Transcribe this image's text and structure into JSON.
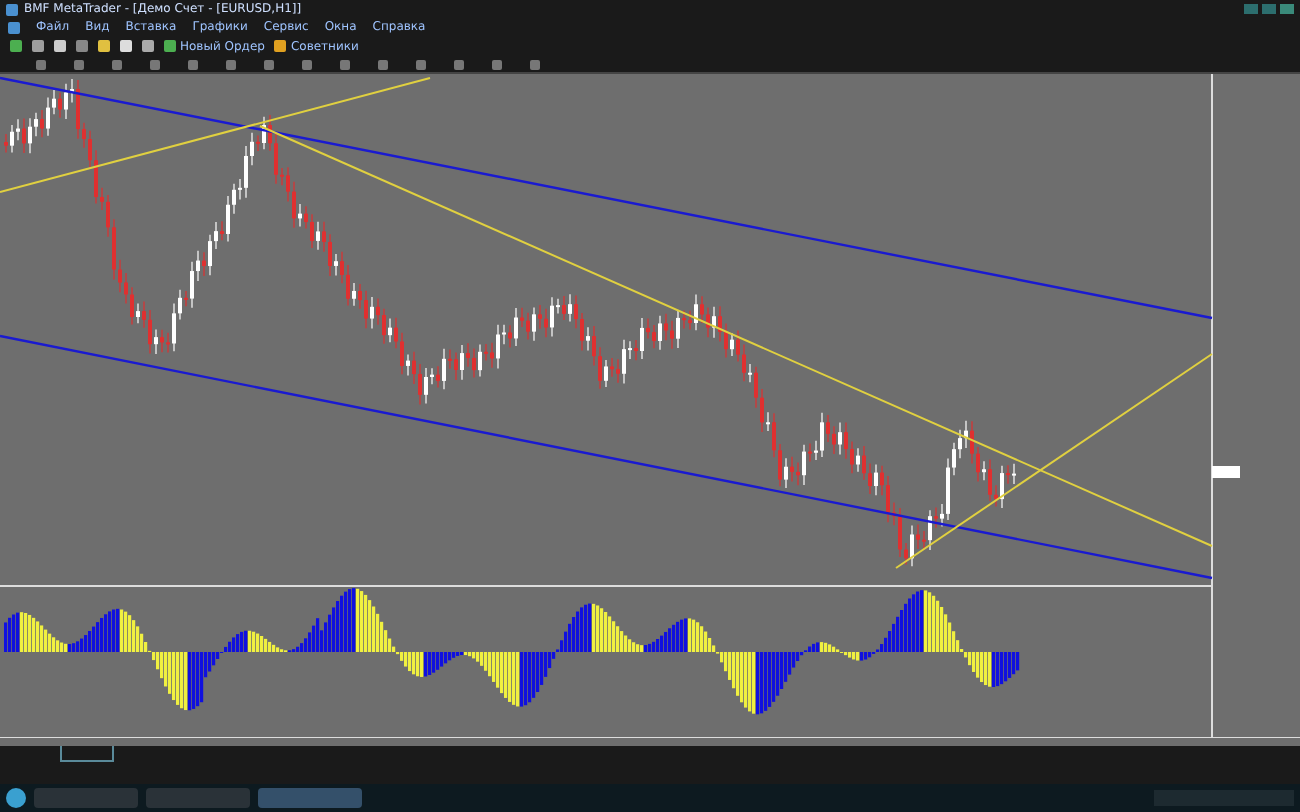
{
  "window": {
    "title": "BMF MetaTrader - [Демо Счет - [EURUSD,H1]]"
  },
  "menu": [
    {
      "label": "Файл"
    },
    {
      "label": "Вид"
    },
    {
      "label": "Вставка"
    },
    {
      "label": "Графики"
    },
    {
      "label": "Сервис"
    },
    {
      "label": "Окна"
    },
    {
      "label": "Справка"
    }
  ],
  "toolbar": [
    {
      "label": "Новый Ордер"
    },
    {
      "label": "Советники"
    }
  ]
}
